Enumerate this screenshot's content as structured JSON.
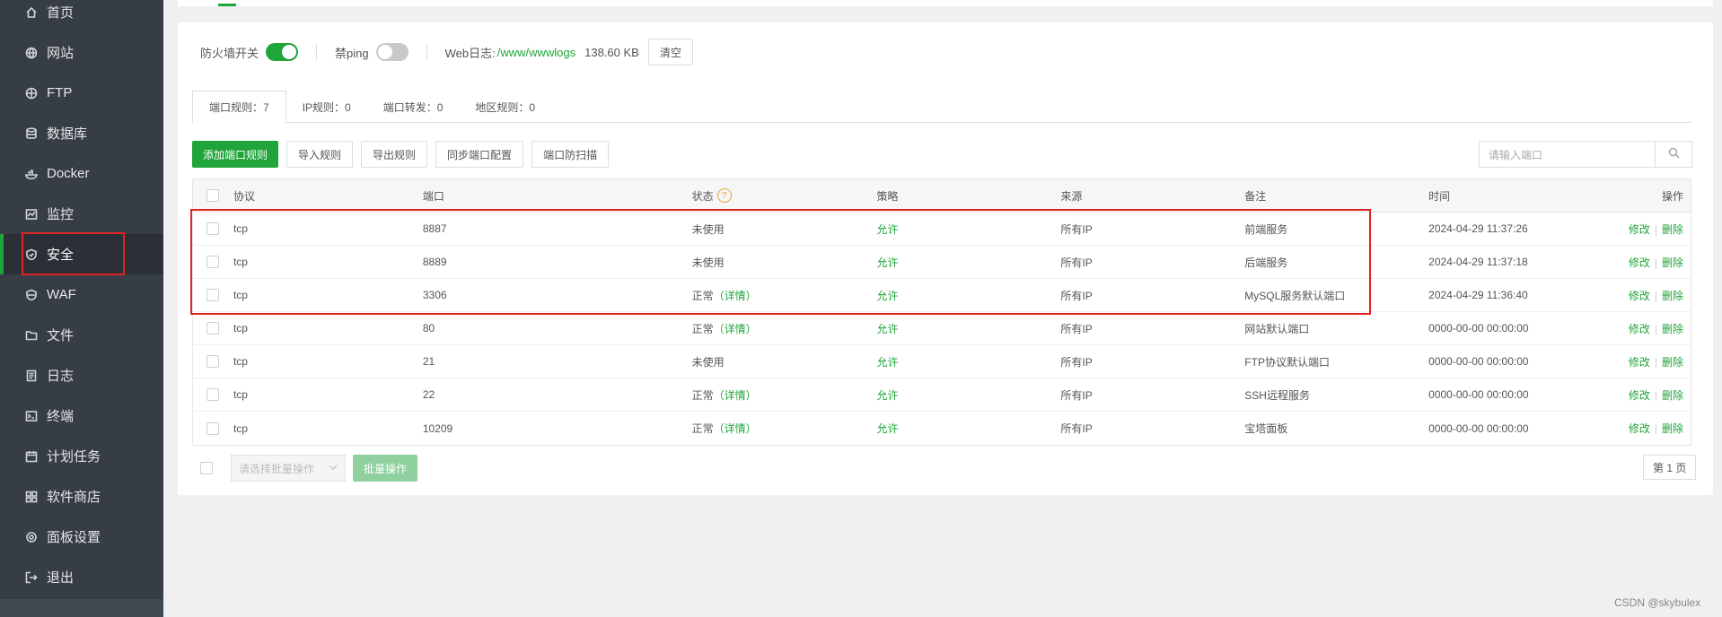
{
  "sidebar": {
    "items": [
      {
        "label": "首页",
        "icon": "home-icon"
      },
      {
        "label": "网站",
        "icon": "globe-icon"
      },
      {
        "label": "FTP",
        "icon": "ftp-icon"
      },
      {
        "label": "数据库",
        "icon": "database-icon"
      },
      {
        "label": "Docker",
        "icon": "docker-icon"
      },
      {
        "label": "监控",
        "icon": "monitor-icon"
      },
      {
        "label": "安全",
        "icon": "shield-icon",
        "active": true
      },
      {
        "label": "WAF",
        "icon": "waf-shield-icon"
      },
      {
        "label": "文件",
        "icon": "folder-icon"
      },
      {
        "label": "日志",
        "icon": "log-icon"
      },
      {
        "label": "终端",
        "icon": "terminal-icon"
      },
      {
        "label": "计划任务",
        "icon": "calendar-icon"
      },
      {
        "label": "软件商店",
        "icon": "apps-icon"
      },
      {
        "label": "面板设置",
        "icon": "settings-icon"
      },
      {
        "label": "退出",
        "icon": "logout-icon"
      }
    ]
  },
  "toolbar": {
    "firewall_label": "防火墙开关",
    "firewall_on": true,
    "ping_label": "禁ping",
    "ping_on": false,
    "weblog_label": "Web日志:",
    "weblog_path": "/www/wwwlogs",
    "weblog_size": "138.60 KB",
    "clear_label": "清空"
  },
  "tabs": [
    {
      "label": "端口规则：7",
      "active": true
    },
    {
      "label": "IP规则：0"
    },
    {
      "label": "端口转发：0"
    },
    {
      "label": "地区规则：0"
    }
  ],
  "actions": {
    "add": "添加端口规则",
    "import": "导入规则",
    "export": "导出规则",
    "sync": "同步端口配置",
    "scan": "端口防扫描"
  },
  "search": {
    "placeholder": "请输入端口"
  },
  "table": {
    "headers": {
      "protocol": "协议",
      "port": "端口",
      "status": "状态",
      "policy": "策略",
      "source": "来源",
      "remark": "备注",
      "time": "时间",
      "ops": "操作"
    },
    "rows": [
      {
        "protocol": "tcp",
        "port": "8887",
        "status": "未使用",
        "detail": "",
        "policy": "允许",
        "source": "所有IP",
        "remark": "前端服务",
        "time": "2024-04-29 11:37:26"
      },
      {
        "protocol": "tcp",
        "port": "8889",
        "status": "未使用",
        "detail": "",
        "policy": "允许",
        "source": "所有IP",
        "remark": "后端服务",
        "time": "2024-04-29 11:37:18"
      },
      {
        "protocol": "tcp",
        "port": "3306",
        "status": "正常",
        "detail": "（详情）",
        "policy": "允许",
        "source": "所有IP",
        "remark": "MySQL服务默认端口",
        "time": "2024-04-29 11:36:40"
      },
      {
        "protocol": "tcp",
        "port": "80",
        "status": "正常",
        "detail": "（详情）",
        "policy": "允许",
        "source": "所有IP",
        "remark": "网站默认端口",
        "time": "0000-00-00 00:00:00"
      },
      {
        "protocol": "tcp",
        "port": "21",
        "status": "未使用",
        "detail": "",
        "policy": "允许",
        "source": "所有IP",
        "remark": "FTP协议默认端口",
        "time": "0000-00-00 00:00:00"
      },
      {
        "protocol": "tcp",
        "port": "22",
        "status": "正常",
        "detail": "（详情）",
        "policy": "允许",
        "source": "所有IP",
        "remark": "SSH远程服务",
        "time": "0000-00-00 00:00:00"
      },
      {
        "protocol": "tcp",
        "port": "10209",
        "status": "正常",
        "detail": "（详情）",
        "policy": "允许",
        "source": "所有IP",
        "remark": "宝塔面板",
        "time": "0000-00-00 00:00:00"
      }
    ],
    "edit_label": "修改",
    "delete_label": "删除"
  },
  "footer": {
    "batch_select_placeholder": "请选择批量操作",
    "batch_button": "批量操作",
    "page_label": "第 1 页"
  },
  "watermark": "CSDN @skybulex",
  "colors": {
    "accent": "#20a53a",
    "sidebar": "#363d47",
    "highlight": "#e02424"
  }
}
